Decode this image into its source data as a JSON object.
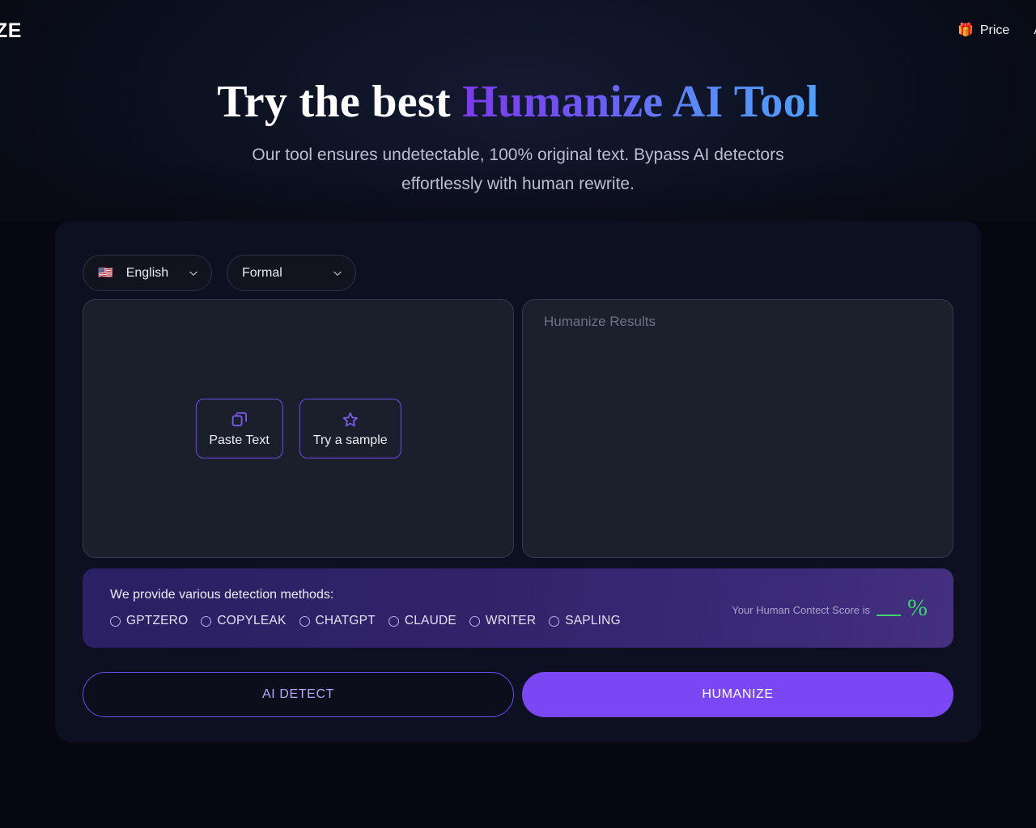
{
  "header": {
    "brand": "ZE",
    "nav": [
      {
        "icon": "gift-icon",
        "glyph": "🎁",
        "label": "Price"
      }
    ],
    "cut_off_item": "A"
  },
  "hero": {
    "title_plain": "Try the best ",
    "title_gradient": "Humanize AI Tool",
    "subtitle": "Our tool ensures undetectable, 100% original text. Bypass AI detectors effortlessly with human rewrite."
  },
  "controls": {
    "language": {
      "flag": "🇺🇸",
      "value": "English"
    },
    "tone": {
      "value": "Formal"
    }
  },
  "editor": {
    "input_actions": [
      {
        "label": "Paste Text",
        "icon": "copy-icon"
      },
      {
        "label": "Try a sample",
        "icon": "star-icon"
      }
    ],
    "output_placeholder": "Humanize Results"
  },
  "detection": {
    "title": "We provide various detection methods:",
    "methods": [
      {
        "label": "GPTZERO",
        "selected": false
      },
      {
        "label": "COPYLEAK",
        "selected": false
      },
      {
        "label": "CHATGPT",
        "selected": false
      },
      {
        "label": "CLAUDE",
        "selected": false
      },
      {
        "label": "WRITER",
        "selected": false
      },
      {
        "label": "SAPLING",
        "selected": false
      }
    ],
    "score_text": "Your Human Contect Score is",
    "score_value": "",
    "score_unit": "%"
  },
  "cta": {
    "detect_label": "AI DETECT",
    "humanize_label": "HUMANIZE"
  },
  "colors": {
    "accent_purple": "#7b47f5",
    "accent_blue": "#4f9fff",
    "score_green": "#3dd36f",
    "page_bg": "#06070f",
    "panel_bg": "#0d1020"
  }
}
